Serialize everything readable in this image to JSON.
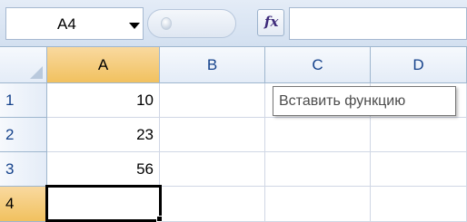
{
  "formula_bar": {
    "name_box_value": "A4",
    "fx_label": "fx",
    "formula_value": ""
  },
  "columns": [
    "A",
    "B",
    "C",
    "D"
  ],
  "active_column": "A",
  "rows": [
    {
      "header": "1",
      "a": "10"
    },
    {
      "header": "2",
      "a": "23"
    },
    {
      "header": "3",
      "a": "56"
    },
    {
      "header": "4",
      "a": ""
    }
  ],
  "active_row": "4",
  "tooltip": "Вставить функцию",
  "colors": {
    "header_text": "#15428b",
    "active_header": "#f1c15f",
    "gridline": "#d0d7e5"
  }
}
